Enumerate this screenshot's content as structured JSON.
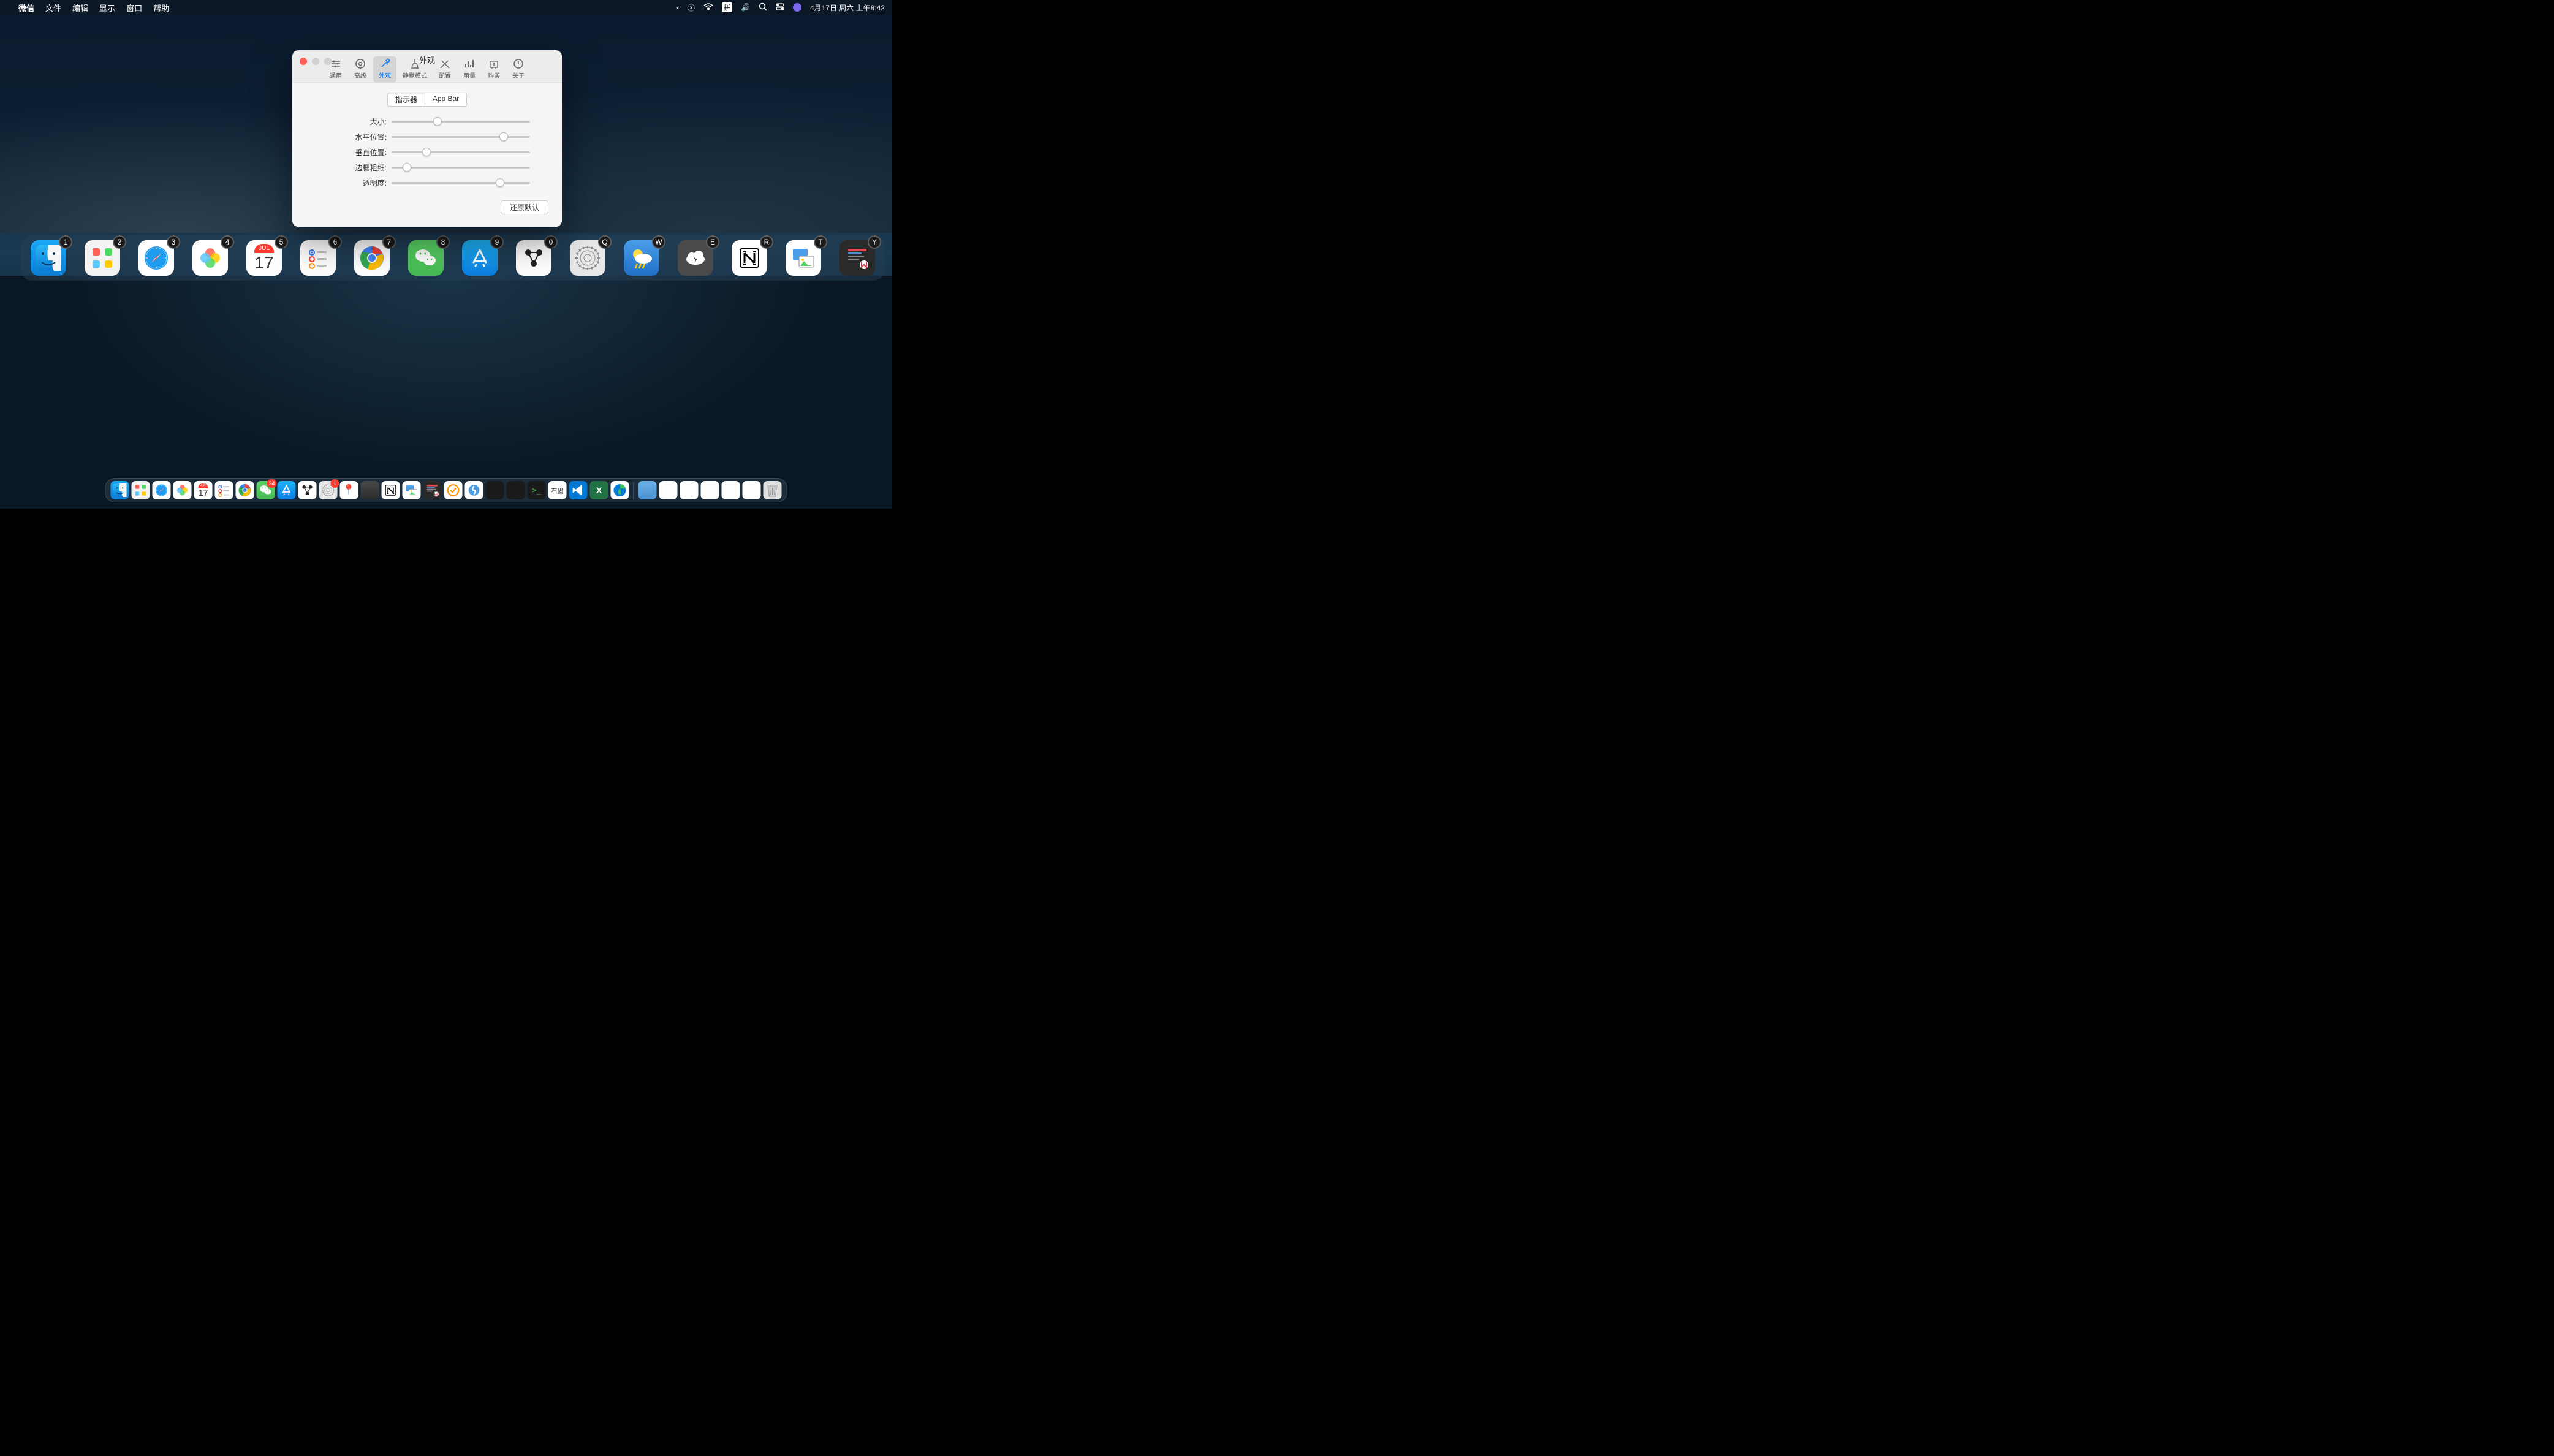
{
  "menubar": {
    "app": "微信",
    "items": [
      "文件",
      "编辑",
      "显示",
      "窗口",
      "帮助"
    ],
    "ime": "拼",
    "datetime": "4月17日 周六 上午8:42"
  },
  "pref": {
    "title": "外观",
    "tabs": [
      {
        "label": "通用"
      },
      {
        "label": "高级"
      },
      {
        "label": "外观"
      },
      {
        "label": "静默模式"
      },
      {
        "label": "配置"
      },
      {
        "label": "用量"
      },
      {
        "label": "购买"
      },
      {
        "label": "关于"
      }
    ],
    "active_tab": 2,
    "seg": [
      "指示器",
      "App Bar"
    ],
    "seg_active": 0,
    "sliders": [
      {
        "label": "大小:",
        "pos": 30
      },
      {
        "label": "水平位置:",
        "pos": 78
      },
      {
        "label": "垂直位置:",
        "pos": 22
      },
      {
        "label": "边框粗细:",
        "pos": 8
      },
      {
        "label": "透明度:",
        "pos": 75
      }
    ],
    "reset": "还原默认"
  },
  "appbar": [
    {
      "badge": "1",
      "name": "finder",
      "cls": "ic-finder"
    },
    {
      "badge": "2",
      "name": "launchpad",
      "cls": "ic-grid"
    },
    {
      "badge": "3",
      "name": "safari",
      "cls": "ic-safari"
    },
    {
      "badge": "4",
      "name": "photos",
      "cls": "ic-photos"
    },
    {
      "badge": "5",
      "name": "calendar",
      "cls": "ic-cal"
    },
    {
      "badge": "6",
      "name": "reminders",
      "cls": "ic-rem"
    },
    {
      "badge": "7",
      "name": "chrome",
      "cls": "ic-chrome"
    },
    {
      "badge": "8",
      "name": "wechat",
      "cls": "ic-wechat"
    },
    {
      "badge": "9",
      "name": "appstore",
      "cls": "ic-appstore"
    },
    {
      "badge": "0",
      "name": "devonthink",
      "cls": "ic-dots"
    },
    {
      "badge": "Q",
      "name": "settings",
      "cls": "ic-settings"
    },
    {
      "badge": "W",
      "name": "weather",
      "cls": "ic-weather"
    },
    {
      "badge": "E",
      "name": "cloud",
      "cls": "ic-cloud"
    },
    {
      "badge": "R",
      "name": "notion",
      "cls": "ic-notion"
    },
    {
      "badge": "T",
      "name": "preview",
      "cls": "ic-preview"
    },
    {
      "badge": "Y",
      "name": "mweb",
      "cls": "ic-mweb"
    }
  ],
  "calendar": {
    "month": "JUL",
    "day": "17"
  },
  "dock": {
    "month": "4月",
    "day": "17",
    "items": [
      {
        "name": "finder",
        "cls": "ic-finder"
      },
      {
        "name": "launchpad",
        "cls": "ic-grid"
      },
      {
        "name": "safari",
        "cls": "ic-safari"
      },
      {
        "name": "photos",
        "cls": "ic-photos"
      },
      {
        "name": "calendar",
        "cls": "ic-cal"
      },
      {
        "name": "reminders",
        "cls": "ic-rem"
      },
      {
        "name": "chrome",
        "cls": "ic-chrome"
      },
      {
        "name": "wechat",
        "cls": "ic-wechat",
        "badge": "24"
      },
      {
        "name": "appstore",
        "cls": "ic-appstore"
      },
      {
        "name": "devonthink",
        "cls": "ic-dots"
      },
      {
        "name": "settings",
        "cls": "ic-settings",
        "badge": "1"
      },
      {
        "name": "googlemaps",
        "cls": "ic-gmap"
      },
      {
        "name": "pages",
        "cls": "ic-pg"
      },
      {
        "name": "notion",
        "cls": "ic-notion"
      },
      {
        "name": "preview",
        "cls": "ic-preview"
      },
      {
        "name": "mweb",
        "cls": "ic-mweb"
      },
      {
        "name": "ticktick",
        "cls": "ic-todo"
      },
      {
        "name": "surge",
        "cls": "ic-surge"
      },
      {
        "name": "istats",
        "cls": "ic-activity"
      },
      {
        "name": "activity",
        "cls": "ic-activity"
      },
      {
        "name": "terminal",
        "cls": "ic-term"
      },
      {
        "name": "shimo",
        "cls": "ic-sm",
        "text": "石墨"
      },
      {
        "name": "vscode",
        "cls": "ic-vscode"
      },
      {
        "name": "excel",
        "cls": "ic-excel"
      },
      {
        "name": "edge",
        "cls": "ic-edge"
      }
    ],
    "right": [
      {
        "name": "desktop",
        "cls": "ic-desk"
      },
      {
        "name": "window1",
        "cls": "ic-misc"
      },
      {
        "name": "window2",
        "cls": "ic-misc"
      },
      {
        "name": "window3",
        "cls": "ic-misc"
      },
      {
        "name": "window4",
        "cls": "ic-misc"
      },
      {
        "name": "window5",
        "cls": "ic-misc"
      },
      {
        "name": "trash",
        "cls": "ic-trash"
      }
    ]
  }
}
